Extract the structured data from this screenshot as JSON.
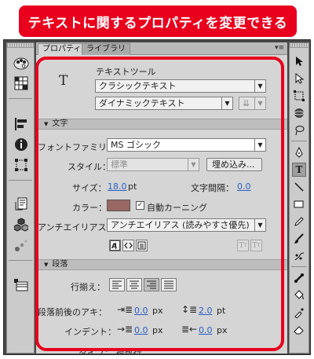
{
  "banner": {
    "title": "テキストに関するプロパティを変更できる"
  },
  "tabs": [
    {
      "label": "プロパティ",
      "active": true
    },
    {
      "label": "ライブラリ",
      "active": false
    }
  ],
  "tool": {
    "icon_text": "T",
    "name": "テキストツール",
    "text_engine": "クラシックテキスト",
    "text_type": "ダイナミックテキスト"
  },
  "character": {
    "header": "文字",
    "font_family_label": "フォントファミリー：",
    "font_family_value": "MS ゴシック",
    "style_label": "スタイル：",
    "style_value": "標準",
    "embed_button": "埋め込み...",
    "size_label": "サイズ：",
    "size_value": "18.0",
    "size_unit": "pt",
    "spacing_label": "文字間隔：",
    "spacing_value": "0.0",
    "color_label": "カラー：",
    "color_hex": "#9a6762",
    "auto_kerning_label": "自動カーニング",
    "auto_kerning_checked": true,
    "antialias_label": "アンチエイリアス：",
    "antialias_value": "アンチエイリアス (読みやすさ優先)"
  },
  "paragraph": {
    "header": "段落",
    "align_label": "行揃え：",
    "spacing_label": "段落前後のアキ：",
    "indent_value": "0.0",
    "indent_unit": "px",
    "line_spacing_value": "2.0",
    "line_spacing_unit": "pt",
    "indent_label": "インデント：",
    "left_margin_value": "0.0",
    "left_margin_unit": "px",
    "right_margin_value": "0.0",
    "right_margin_unit": "px",
    "behavior_partial": "タイプ：  複数行"
  },
  "colors": {
    "highlight": "#e8001d",
    "link_blue": "#2a5fc4"
  }
}
